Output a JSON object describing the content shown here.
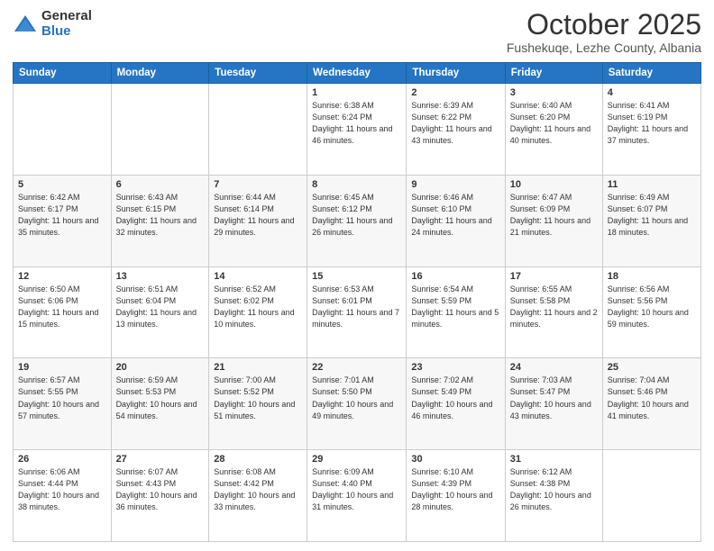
{
  "logo": {
    "general": "General",
    "blue": "Blue"
  },
  "header": {
    "month": "October 2025",
    "location": "Fushekuqe, Lezhe County, Albania"
  },
  "weekdays": [
    "Sunday",
    "Monday",
    "Tuesday",
    "Wednesday",
    "Thursday",
    "Friday",
    "Saturday"
  ],
  "weeks": [
    [
      {
        "day": "",
        "info": ""
      },
      {
        "day": "",
        "info": ""
      },
      {
        "day": "",
        "info": ""
      },
      {
        "day": "1",
        "info": "Sunrise: 6:38 AM\nSunset: 6:24 PM\nDaylight: 11 hours and 46 minutes."
      },
      {
        "day": "2",
        "info": "Sunrise: 6:39 AM\nSunset: 6:22 PM\nDaylight: 11 hours and 43 minutes."
      },
      {
        "day": "3",
        "info": "Sunrise: 6:40 AM\nSunset: 6:20 PM\nDaylight: 11 hours and 40 minutes."
      },
      {
        "day": "4",
        "info": "Sunrise: 6:41 AM\nSunset: 6:19 PM\nDaylight: 11 hours and 37 minutes."
      }
    ],
    [
      {
        "day": "5",
        "info": "Sunrise: 6:42 AM\nSunset: 6:17 PM\nDaylight: 11 hours and 35 minutes."
      },
      {
        "day": "6",
        "info": "Sunrise: 6:43 AM\nSunset: 6:15 PM\nDaylight: 11 hours and 32 minutes."
      },
      {
        "day": "7",
        "info": "Sunrise: 6:44 AM\nSunset: 6:14 PM\nDaylight: 11 hours and 29 minutes."
      },
      {
        "day": "8",
        "info": "Sunrise: 6:45 AM\nSunset: 6:12 PM\nDaylight: 11 hours and 26 minutes."
      },
      {
        "day": "9",
        "info": "Sunrise: 6:46 AM\nSunset: 6:10 PM\nDaylight: 11 hours and 24 minutes."
      },
      {
        "day": "10",
        "info": "Sunrise: 6:47 AM\nSunset: 6:09 PM\nDaylight: 11 hours and 21 minutes."
      },
      {
        "day": "11",
        "info": "Sunrise: 6:49 AM\nSunset: 6:07 PM\nDaylight: 11 hours and 18 minutes."
      }
    ],
    [
      {
        "day": "12",
        "info": "Sunrise: 6:50 AM\nSunset: 6:06 PM\nDaylight: 11 hours and 15 minutes."
      },
      {
        "day": "13",
        "info": "Sunrise: 6:51 AM\nSunset: 6:04 PM\nDaylight: 11 hours and 13 minutes."
      },
      {
        "day": "14",
        "info": "Sunrise: 6:52 AM\nSunset: 6:02 PM\nDaylight: 11 hours and 10 minutes."
      },
      {
        "day": "15",
        "info": "Sunrise: 6:53 AM\nSunset: 6:01 PM\nDaylight: 11 hours and 7 minutes."
      },
      {
        "day": "16",
        "info": "Sunrise: 6:54 AM\nSunset: 5:59 PM\nDaylight: 11 hours and 5 minutes."
      },
      {
        "day": "17",
        "info": "Sunrise: 6:55 AM\nSunset: 5:58 PM\nDaylight: 11 hours and 2 minutes."
      },
      {
        "day": "18",
        "info": "Sunrise: 6:56 AM\nSunset: 5:56 PM\nDaylight: 10 hours and 59 minutes."
      }
    ],
    [
      {
        "day": "19",
        "info": "Sunrise: 6:57 AM\nSunset: 5:55 PM\nDaylight: 10 hours and 57 minutes."
      },
      {
        "day": "20",
        "info": "Sunrise: 6:59 AM\nSunset: 5:53 PM\nDaylight: 10 hours and 54 minutes."
      },
      {
        "day": "21",
        "info": "Sunrise: 7:00 AM\nSunset: 5:52 PM\nDaylight: 10 hours and 51 minutes."
      },
      {
        "day": "22",
        "info": "Sunrise: 7:01 AM\nSunset: 5:50 PM\nDaylight: 10 hours and 49 minutes."
      },
      {
        "day": "23",
        "info": "Sunrise: 7:02 AM\nSunset: 5:49 PM\nDaylight: 10 hours and 46 minutes."
      },
      {
        "day": "24",
        "info": "Sunrise: 7:03 AM\nSunset: 5:47 PM\nDaylight: 10 hours and 43 minutes."
      },
      {
        "day": "25",
        "info": "Sunrise: 7:04 AM\nSunset: 5:46 PM\nDaylight: 10 hours and 41 minutes."
      }
    ],
    [
      {
        "day": "26",
        "info": "Sunrise: 6:06 AM\nSunset: 4:44 PM\nDaylight: 10 hours and 38 minutes."
      },
      {
        "day": "27",
        "info": "Sunrise: 6:07 AM\nSunset: 4:43 PM\nDaylight: 10 hours and 36 minutes."
      },
      {
        "day": "28",
        "info": "Sunrise: 6:08 AM\nSunset: 4:42 PM\nDaylight: 10 hours and 33 minutes."
      },
      {
        "day": "29",
        "info": "Sunrise: 6:09 AM\nSunset: 4:40 PM\nDaylight: 10 hours and 31 minutes."
      },
      {
        "day": "30",
        "info": "Sunrise: 6:10 AM\nSunset: 4:39 PM\nDaylight: 10 hours and 28 minutes."
      },
      {
        "day": "31",
        "info": "Sunrise: 6:12 AM\nSunset: 4:38 PM\nDaylight: 10 hours and 26 minutes."
      },
      {
        "day": "",
        "info": ""
      }
    ]
  ]
}
